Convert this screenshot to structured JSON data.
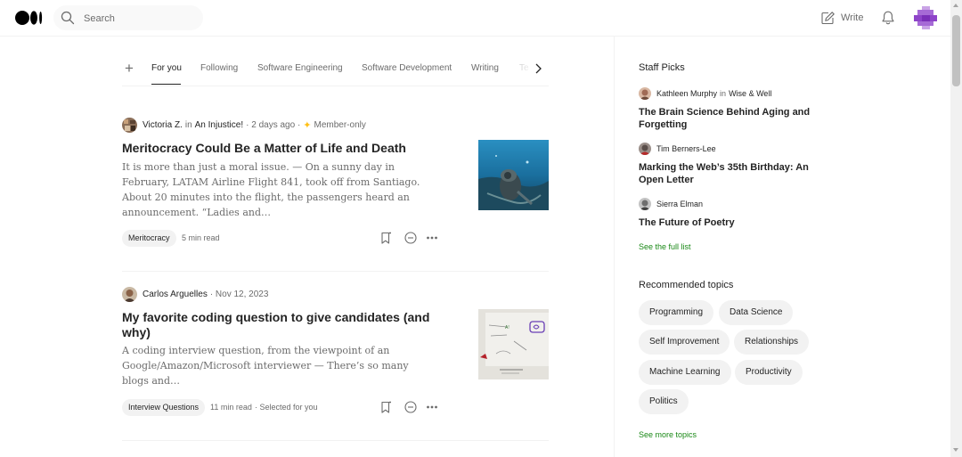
{
  "header": {
    "logo": "medium-logo",
    "search_placeholder": "Search",
    "write_label": "Write"
  },
  "tabs": [
    {
      "label": "For you",
      "active": true
    },
    {
      "label": "Following"
    },
    {
      "label": "Software Engineering"
    },
    {
      "label": "Software Development"
    },
    {
      "label": "Writing"
    },
    {
      "label": "Te"
    }
  ],
  "articles": [
    {
      "author": "Victoria Z.",
      "in_word": "in",
      "publication": "An Injustice!",
      "date": "· 2 days ago ·",
      "member_only": "Member-only",
      "title": "Meritocracy Could Be a Matter of Life and Death",
      "snippet": "It is more than just a moral issue. — On a sunny day in February, LATAM Airline Flight 841, took off from Santiago. About 20 minutes into the flight, the passengers heard an announcement. “Ladies and…",
      "tag": "Meritocracy",
      "read_time": "5 min read"
    },
    {
      "author": "Carlos Arguelles",
      "date": "· Nov 12, 2023",
      "title": "My favorite coding question to give candidates (and why)",
      "snippet": "A coding interview question, from the viewpoint of an Google/Amazon/Microsoft interviewer — There’s so many blogs and…",
      "tag": "Interview Questions",
      "read_time": "11 min read",
      "selected": "· Selected for you"
    }
  ],
  "sidebar": {
    "staff_picks_heading": "Staff Picks",
    "picks": [
      {
        "author": "Kathleen Murphy",
        "in_word": "in",
        "publication": "Wise & Well",
        "title": "The Brain Science Behind Aging and Forgetting"
      },
      {
        "author": "Tim Berners-Lee",
        "title": "Marking the Web’s 35th Birthday: An Open Letter"
      },
      {
        "author": "Sierra Elman",
        "title": "The Future of Poetry"
      }
    ],
    "see_full_list": "See the full list",
    "recommended_heading": "Recommended topics",
    "topics": [
      "Programming",
      "Data Science",
      "Self Improvement",
      "Relationships",
      "Machine Learning",
      "Productivity",
      "Politics"
    ],
    "see_more_topics": "See more topics"
  },
  "colors": {
    "accent_green": "#1a8917",
    "member_star": "#ffc017",
    "text_primary": "#242424",
    "text_secondary": "#6b6b6b",
    "chip_bg": "#f2f2f2"
  }
}
